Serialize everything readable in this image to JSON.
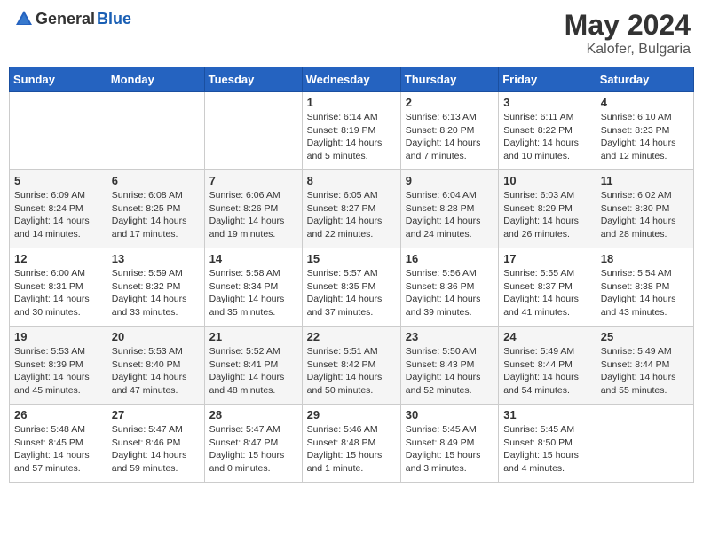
{
  "header": {
    "logo_general": "General",
    "logo_blue": "Blue",
    "month_year": "May 2024",
    "location": "Kalofer, Bulgaria"
  },
  "weekdays": [
    "Sunday",
    "Monday",
    "Tuesday",
    "Wednesday",
    "Thursday",
    "Friday",
    "Saturday"
  ],
  "weeks": [
    [
      {
        "day": "",
        "info": ""
      },
      {
        "day": "",
        "info": ""
      },
      {
        "day": "",
        "info": ""
      },
      {
        "day": "1",
        "info": "Sunrise: 6:14 AM\nSunset: 8:19 PM\nDaylight: 14 hours\nand 5 minutes."
      },
      {
        "day": "2",
        "info": "Sunrise: 6:13 AM\nSunset: 8:20 PM\nDaylight: 14 hours\nand 7 minutes."
      },
      {
        "day": "3",
        "info": "Sunrise: 6:11 AM\nSunset: 8:22 PM\nDaylight: 14 hours\nand 10 minutes."
      },
      {
        "day": "4",
        "info": "Sunrise: 6:10 AM\nSunset: 8:23 PM\nDaylight: 14 hours\nand 12 minutes."
      }
    ],
    [
      {
        "day": "5",
        "info": "Sunrise: 6:09 AM\nSunset: 8:24 PM\nDaylight: 14 hours\nand 14 minutes."
      },
      {
        "day": "6",
        "info": "Sunrise: 6:08 AM\nSunset: 8:25 PM\nDaylight: 14 hours\nand 17 minutes."
      },
      {
        "day": "7",
        "info": "Sunrise: 6:06 AM\nSunset: 8:26 PM\nDaylight: 14 hours\nand 19 minutes."
      },
      {
        "day": "8",
        "info": "Sunrise: 6:05 AM\nSunset: 8:27 PM\nDaylight: 14 hours\nand 22 minutes."
      },
      {
        "day": "9",
        "info": "Sunrise: 6:04 AM\nSunset: 8:28 PM\nDaylight: 14 hours\nand 24 minutes."
      },
      {
        "day": "10",
        "info": "Sunrise: 6:03 AM\nSunset: 8:29 PM\nDaylight: 14 hours\nand 26 minutes."
      },
      {
        "day": "11",
        "info": "Sunrise: 6:02 AM\nSunset: 8:30 PM\nDaylight: 14 hours\nand 28 minutes."
      }
    ],
    [
      {
        "day": "12",
        "info": "Sunrise: 6:00 AM\nSunset: 8:31 PM\nDaylight: 14 hours\nand 30 minutes."
      },
      {
        "day": "13",
        "info": "Sunrise: 5:59 AM\nSunset: 8:32 PM\nDaylight: 14 hours\nand 33 minutes."
      },
      {
        "day": "14",
        "info": "Sunrise: 5:58 AM\nSunset: 8:34 PM\nDaylight: 14 hours\nand 35 minutes."
      },
      {
        "day": "15",
        "info": "Sunrise: 5:57 AM\nSunset: 8:35 PM\nDaylight: 14 hours\nand 37 minutes."
      },
      {
        "day": "16",
        "info": "Sunrise: 5:56 AM\nSunset: 8:36 PM\nDaylight: 14 hours\nand 39 minutes."
      },
      {
        "day": "17",
        "info": "Sunrise: 5:55 AM\nSunset: 8:37 PM\nDaylight: 14 hours\nand 41 minutes."
      },
      {
        "day": "18",
        "info": "Sunrise: 5:54 AM\nSunset: 8:38 PM\nDaylight: 14 hours\nand 43 minutes."
      }
    ],
    [
      {
        "day": "19",
        "info": "Sunrise: 5:53 AM\nSunset: 8:39 PM\nDaylight: 14 hours\nand 45 minutes."
      },
      {
        "day": "20",
        "info": "Sunrise: 5:53 AM\nSunset: 8:40 PM\nDaylight: 14 hours\nand 47 minutes."
      },
      {
        "day": "21",
        "info": "Sunrise: 5:52 AM\nSunset: 8:41 PM\nDaylight: 14 hours\nand 48 minutes."
      },
      {
        "day": "22",
        "info": "Sunrise: 5:51 AM\nSunset: 8:42 PM\nDaylight: 14 hours\nand 50 minutes."
      },
      {
        "day": "23",
        "info": "Sunrise: 5:50 AM\nSunset: 8:43 PM\nDaylight: 14 hours\nand 52 minutes."
      },
      {
        "day": "24",
        "info": "Sunrise: 5:49 AM\nSunset: 8:44 PM\nDaylight: 14 hours\nand 54 minutes."
      },
      {
        "day": "25",
        "info": "Sunrise: 5:49 AM\nSunset: 8:44 PM\nDaylight: 14 hours\nand 55 minutes."
      }
    ],
    [
      {
        "day": "26",
        "info": "Sunrise: 5:48 AM\nSunset: 8:45 PM\nDaylight: 14 hours\nand 57 minutes."
      },
      {
        "day": "27",
        "info": "Sunrise: 5:47 AM\nSunset: 8:46 PM\nDaylight: 14 hours\nand 59 minutes."
      },
      {
        "day": "28",
        "info": "Sunrise: 5:47 AM\nSunset: 8:47 PM\nDaylight: 15 hours\nand 0 minutes."
      },
      {
        "day": "29",
        "info": "Sunrise: 5:46 AM\nSunset: 8:48 PM\nDaylight: 15 hours\nand 1 minute."
      },
      {
        "day": "30",
        "info": "Sunrise: 5:45 AM\nSunset: 8:49 PM\nDaylight: 15 hours\nand 3 minutes."
      },
      {
        "day": "31",
        "info": "Sunrise: 5:45 AM\nSunset: 8:50 PM\nDaylight: 15 hours\nand 4 minutes."
      },
      {
        "day": "",
        "info": ""
      }
    ]
  ]
}
